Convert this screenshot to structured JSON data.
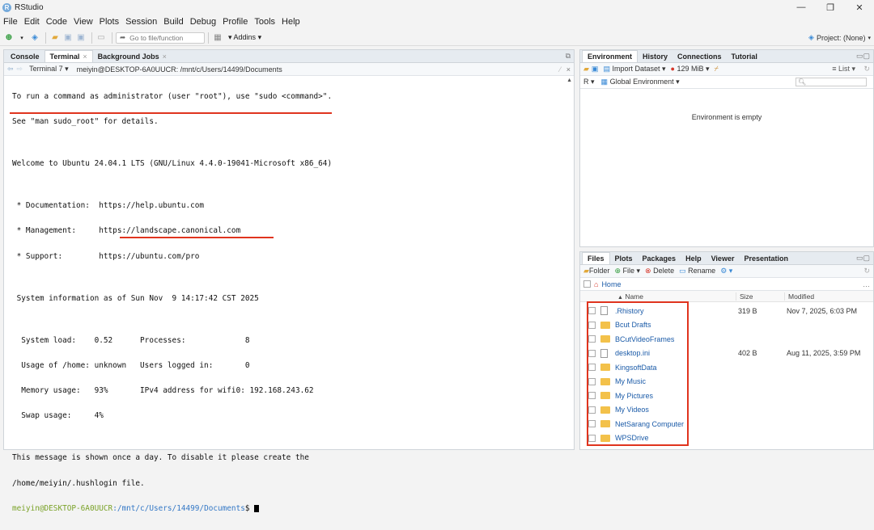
{
  "window": {
    "title": "RStudio"
  },
  "menu": [
    "File",
    "Edit",
    "Code",
    "View",
    "Plots",
    "Session",
    "Build",
    "Debug",
    "Profile",
    "Tools",
    "Help"
  ],
  "toolbar": {
    "goto_placeholder": "Go to file/function",
    "addins": "Addins",
    "project": "Project: (None)"
  },
  "left_pane": {
    "tabs": [
      "Console",
      "Terminal",
      "Background Jobs"
    ],
    "terminal_select": "Terminal 7",
    "terminal_path": "meiyin@DESKTOP-6A0UUCR: /mnt/c/Users/14499/Documents",
    "lines": [
      "To run a command as administrator (user \"root\"), use \"sudo <command>\".",
      "See \"man sudo_root\" for details.",
      "",
      "Welcome to Ubuntu 24.04.1 LTS (GNU/Linux 4.4.0-19041-Microsoft x86_64)",
      "",
      " * Documentation:  https://help.ubuntu.com",
      " * Management:     https://landscape.canonical.com",
      " * Support:        https://ubuntu.com/pro",
      "",
      " System information as of Sun Nov  9 14:17:42 CST 2025",
      "",
      "  System load:    0.52      Processes:             8",
      "  Usage of /home: unknown   Users logged in:       0",
      "  Memory usage:   93%       IPv4 address for wifi0: 192.168.243.62",
      "  Swap usage:     4%",
      "",
      "This message is shown once a day. To disable it please create the",
      "/home/meiyin/.hushlogin file."
    ],
    "prompt_user": "meiyin@DESKTOP-6A0UUCR",
    "prompt_path": ":/mnt/c/Users/14499/Documents",
    "prompt_symbol": "$ "
  },
  "env_pane": {
    "tabs": [
      "Environment",
      "History",
      "Connections",
      "Tutorial"
    ],
    "import_dataset": "Import Dataset",
    "memory": "129 MiB",
    "list_label": "List",
    "lang": "R",
    "scope": "Global Environment",
    "empty_message": "Environment is empty"
  },
  "files_pane": {
    "tabs": [
      "Files",
      "Plots",
      "Packages",
      "Help",
      "Viewer",
      "Presentation"
    ],
    "actions": {
      "folder": "Folder",
      "file": "File",
      "delete": "Delete",
      "rename": "Rename"
    },
    "breadcrumb": "Home",
    "columns": {
      "name": "Name",
      "size": "Size",
      "modified": "Modified"
    },
    "rows": [
      {
        "name": ".Rhistory",
        "type": "file",
        "size": "319 B",
        "modified": "Nov 7, 2025, 6:03 PM"
      },
      {
        "name": "Bcut Drafts",
        "type": "folder",
        "size": "",
        "modified": ""
      },
      {
        "name": "BCutVideoFrames",
        "type": "folder",
        "size": "",
        "modified": ""
      },
      {
        "name": "desktop.ini",
        "type": "file",
        "size": "402 B",
        "modified": "Aug 11, 2025, 3:59 PM"
      },
      {
        "name": "KingsoftData",
        "type": "folder",
        "size": "",
        "modified": ""
      },
      {
        "name": "My Music",
        "type": "folder",
        "size": "",
        "modified": ""
      },
      {
        "name": "My Pictures",
        "type": "folder",
        "size": "",
        "modified": ""
      },
      {
        "name": "My Videos",
        "type": "folder",
        "size": "",
        "modified": ""
      },
      {
        "name": "NetSarang Computer",
        "type": "folder",
        "size": "",
        "modified": ""
      },
      {
        "name": "WPSDrive",
        "type": "folder",
        "size": "",
        "modified": ""
      }
    ]
  }
}
